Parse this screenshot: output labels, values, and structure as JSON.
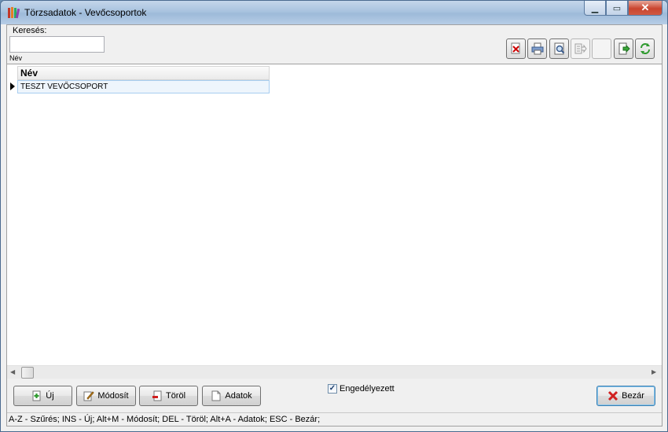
{
  "window": {
    "title": "Törzsadatok - Vevőcsoportok",
    "controls": {
      "minimize": "▁",
      "maximize": "▭",
      "close": "✕"
    }
  },
  "search": {
    "label": "Keresés:",
    "value": "",
    "field_label": "Név"
  },
  "toolbar": {
    "icons": [
      "clear-filter-icon",
      "print-icon",
      "print-preview-icon",
      "export-icon",
      "blank",
      "exit-icon",
      "refresh-icon"
    ]
  },
  "grid": {
    "columns": [
      "Név"
    ],
    "rows": [
      {
        "nev": "TESZT VEVŐCSOPORT"
      }
    ]
  },
  "buttons": {
    "new": "Új",
    "modify": "Módosít",
    "delete": "Töröl",
    "data": "Adatok",
    "close": "Bezár"
  },
  "enabled_checkbox": {
    "label": "Engedélyezett",
    "checked": true
  },
  "status": "A-Z - Szűrés; INS - Új; Alt+M - Módosít; DEL - Töröl; Alt+A - Adatok; ESC - Bezár;"
}
